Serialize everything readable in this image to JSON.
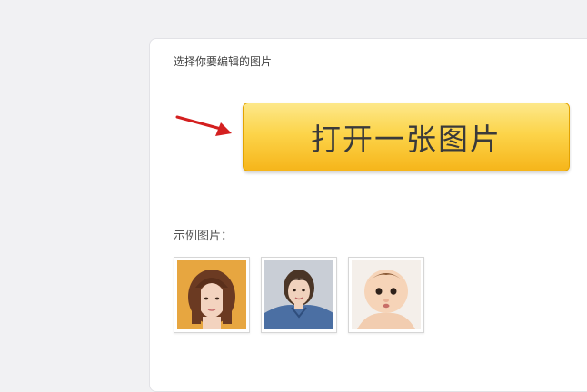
{
  "editor": {
    "prompt": "选择你要编辑的图片",
    "open_button_label": "打开一张图片",
    "examples_label": "示例图片："
  },
  "examples": [
    {
      "name": "sample-photo-woman-bangs"
    },
    {
      "name": "sample-photo-woman-denim"
    },
    {
      "name": "sample-photo-baby"
    }
  ],
  "colors": {
    "button_top": "#fde88a",
    "button_bottom": "#f6b51a",
    "arrow": "#d42020",
    "background": "#f1f1f3"
  }
}
